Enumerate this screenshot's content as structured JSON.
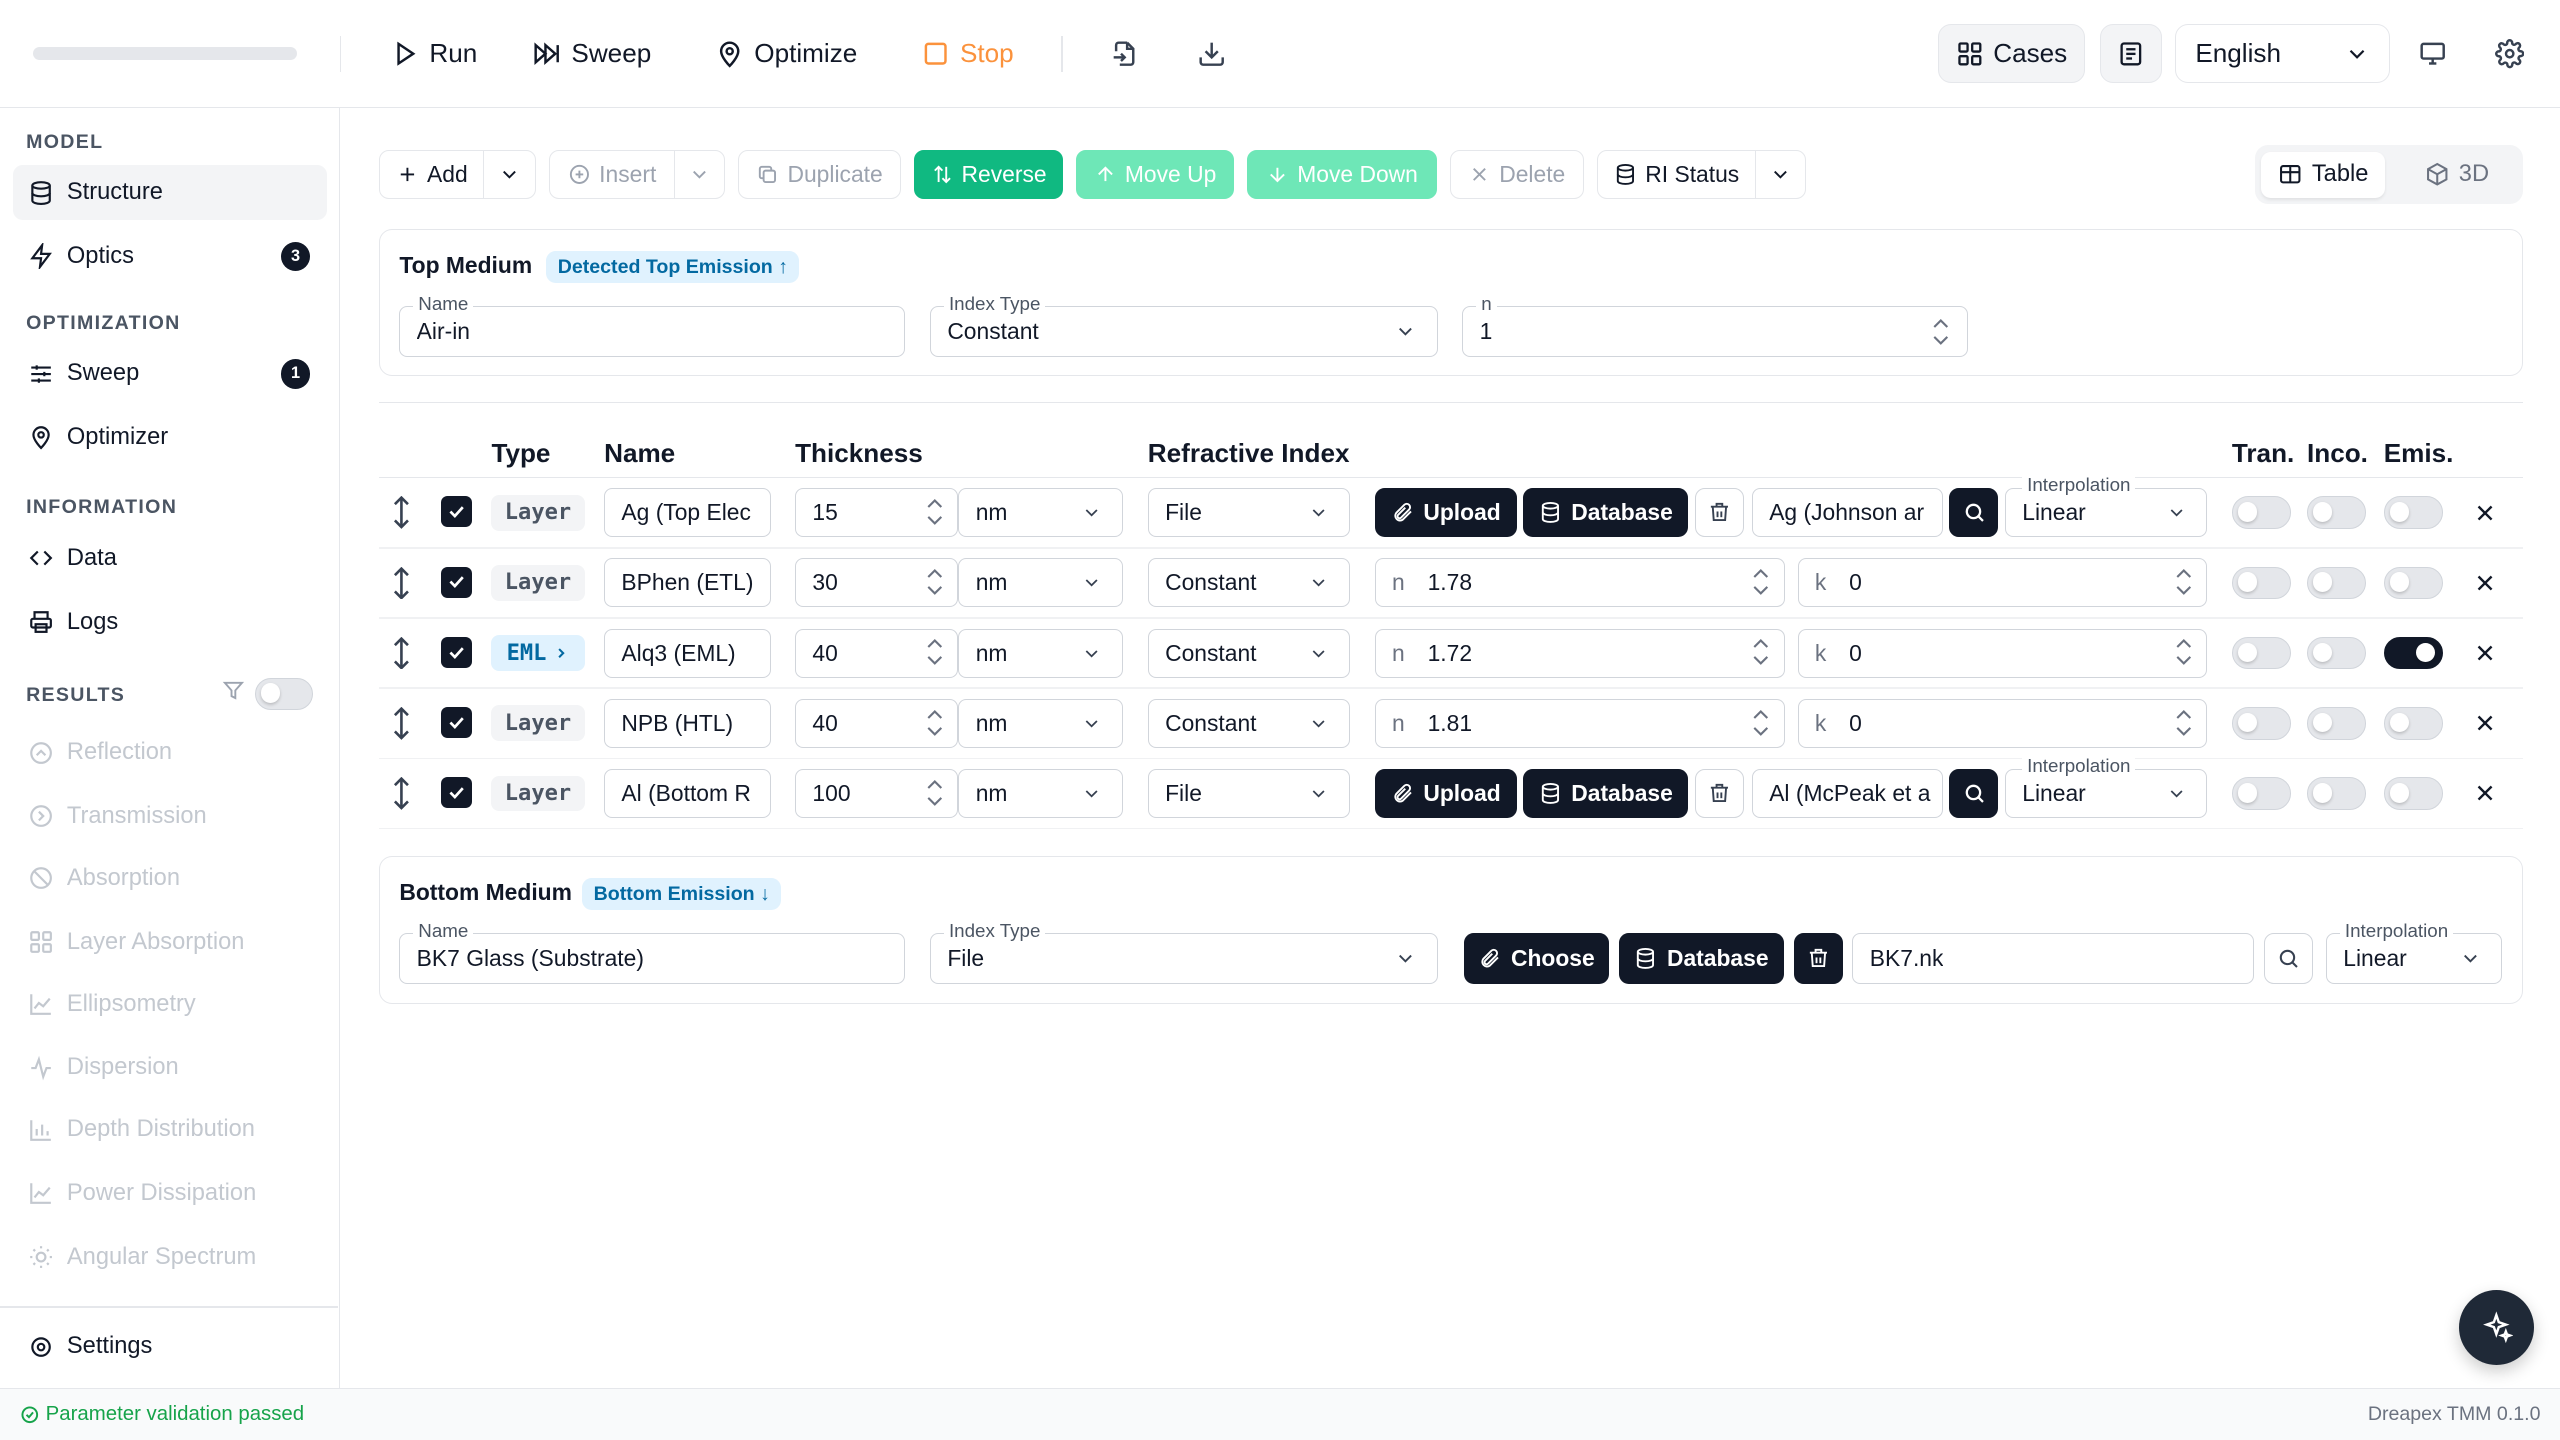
{
  "topbar": {
    "run": "Run",
    "sweep": "Sweep",
    "optimize": "Optimize",
    "stop": "Stop",
    "cases": "Cases",
    "language": "English"
  },
  "sidebar": {
    "model_title": "MODEL",
    "structure": "Structure",
    "optics": "Optics",
    "optics_badge": "3",
    "optimization_title": "OPTIMIZATION",
    "sweep": "Sweep",
    "sweep_badge": "1",
    "optimizer": "Optimizer",
    "information_title": "INFORMATION",
    "data": "Data",
    "logs": "Logs",
    "results_title": "RESULTS",
    "results_filter_on": false,
    "results": [
      "Reflection",
      "Transmission",
      "Absorption",
      "Layer Absorption",
      "Ellipsometry",
      "Dispersion",
      "Depth Distribution",
      "Power Dissipation",
      "Angular Spectrum"
    ],
    "settings": "Settings"
  },
  "toolbar": {
    "add": "Add",
    "insert": "Insert",
    "duplicate": "Duplicate",
    "reverse": "Reverse",
    "move_up": "Move Up",
    "move_down": "Move Down",
    "delete": "Delete",
    "ri_status": "RI Status",
    "view_table": "Table",
    "view_3d": "3D"
  },
  "top_medium": {
    "title": "Top Medium",
    "badge": "Detected Top Emission ↑",
    "name_label": "Name",
    "name": "Air-in",
    "index_type_label": "Index Type",
    "index_type": "Constant",
    "n_label": "n",
    "n": "1"
  },
  "table": {
    "headers": {
      "type": "Type",
      "name": "Name",
      "thickness": "Thickness",
      "refractive_index": "Refractive Index",
      "tran": "Tran.",
      "inco": "Inco.",
      "emis": "Emis."
    },
    "upload": "Upload",
    "database": "Database",
    "interpolation_label": "Interpolation",
    "n_prefix": "n",
    "k_prefix": "k",
    "rows": [
      {
        "type": "Layer",
        "name": "Ag (Top Elec",
        "thickness": "15",
        "unit": "nm",
        "ri_mode": "File",
        "material": "Ag (Johnson ar",
        "interpolation": "Linear",
        "tran": false,
        "inco": false,
        "emis": false
      },
      {
        "type": "Layer",
        "name": "BPhen (ETL)",
        "thickness": "30",
        "unit": "nm",
        "ri_mode": "Constant",
        "n": "1.78",
        "k": "0",
        "tran": false,
        "inco": false,
        "emis": false
      },
      {
        "type": "EML",
        "name": "Alq3 (EML)",
        "thickness": "40",
        "unit": "nm",
        "ri_mode": "Constant",
        "n": "1.72",
        "k": "0",
        "tran": false,
        "inco": false,
        "emis": true
      },
      {
        "type": "Layer",
        "name": "NPB (HTL)",
        "thickness": "40",
        "unit": "nm",
        "ri_mode": "Constant",
        "n": "1.81",
        "k": "0",
        "tran": false,
        "inco": false,
        "emis": false
      },
      {
        "type": "Layer",
        "name": "Al (Bottom R",
        "thickness": "100",
        "unit": "nm",
        "ri_mode": "File",
        "material": "Al (McPeak et a",
        "interpolation": "Linear",
        "tran": false,
        "inco": false,
        "emis": false
      }
    ]
  },
  "bottom_medium": {
    "title": "Bottom Medium",
    "badge": "Bottom Emission ↓",
    "name_label": "Name",
    "name": "BK7 Glass (Substrate)",
    "index_type_label": "Index Type",
    "index_type": "File",
    "choose": "Choose",
    "database": "Database",
    "file": "BK7.nk",
    "interpolation_label": "Interpolation",
    "interpolation": "Linear"
  },
  "status": {
    "message": "Parameter validation passed",
    "version": "Dreapex TMM 0.1.0"
  }
}
